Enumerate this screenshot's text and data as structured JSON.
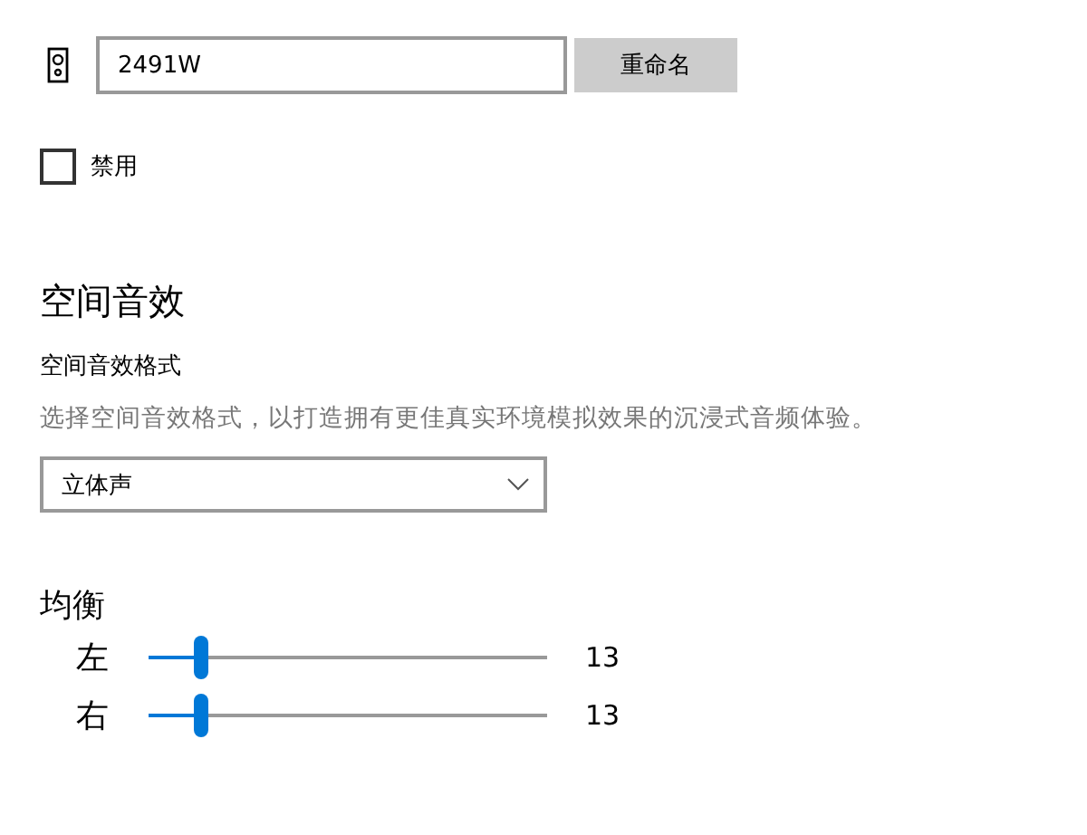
{
  "device": {
    "name_field": {
      "value": "2491W"
    },
    "rename_button": "重命名"
  },
  "disable": {
    "label": "禁用",
    "checked": false
  },
  "spatial_sound": {
    "heading": "空间音效",
    "format_label": "空间音效格式",
    "description": "选择空间音效格式，以打造拥有更佳真实环境模拟效果的沉浸式音频体验。",
    "format_dropdown": {
      "value": "立体声"
    }
  },
  "balance": {
    "heading": "均衡",
    "channels": [
      {
        "label": "左",
        "level": 0.13,
        "reading": "13"
      },
      {
        "label": "右",
        "level": 0.13,
        "reading": "13"
      }
    ]
  }
}
